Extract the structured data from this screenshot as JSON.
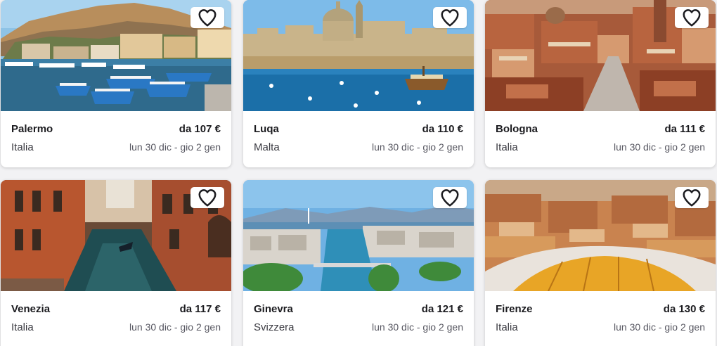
{
  "cards": [
    {
      "city": "Palermo",
      "price": "da 107 €",
      "country": "Italia",
      "dates": "lun 30 dic - gio 2 gen",
      "image": "palermo-harbor-photo"
    },
    {
      "city": "Luqa",
      "price": "da 110 €",
      "country": "Malta",
      "dates": "lun 30 dic - gio 2 gen",
      "image": "valletta-skyline-photo"
    },
    {
      "city": "Bologna",
      "price": "da 111 €",
      "country": "Italia",
      "dates": "lun 30 dic - gio 2 gen",
      "image": "bologna-rooftops-photo"
    },
    {
      "city": "Venezia",
      "price": "da 117 €",
      "country": "Italia",
      "dates": "lun 30 dic - gio 2 gen",
      "image": "venice-canal-photo"
    },
    {
      "city": "Ginevra",
      "price": "da 121 €",
      "country": "Svizzera",
      "dates": "lun 30 dic - gio 2 gen",
      "image": "geneva-lake-photo"
    },
    {
      "city": "Firenze",
      "price": "da 130 €",
      "country": "Italia",
      "dates": "lun 30 dic - gio 2 gen",
      "image": "florence-rooftops-photo"
    }
  ],
  "icons": {
    "favorite": "heart-outline-icon"
  }
}
